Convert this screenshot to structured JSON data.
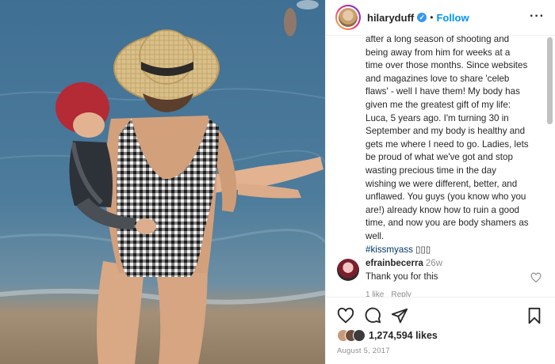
{
  "post": {
    "username": "hilaryduff",
    "verified_mark": "✓",
    "separator": "•",
    "follow_label": "Follow",
    "more_label": "···",
    "caption_lines": [
      "after a long season of shooting and",
      "being away from him for weeks at a",
      "time over those months. Since websites",
      "and magazines love to share 'celeb",
      "flaws' - well I have them! My body has",
      "given me the greatest gift of my life:",
      "Luca, 5 years ago. I'm turning 30 in",
      "September and my body is healthy and",
      "gets me where I need to go. Ladies, lets",
      "be proud of what we've got and stop",
      "wasting precious time in the day",
      "wishing we were different, better, and",
      "unflawed. You guys (you know who you",
      "are!) already know how to ruin a good",
      "time, and now you are body shamers as",
      "well."
    ],
    "hashtag": "#kissmyass",
    "emoji_tail": "▯▯▯",
    "likes": "1,274,594 likes",
    "date": "August 5, 2017"
  },
  "comment": {
    "username": "efrainbecerra",
    "time": "26w",
    "text": "Thank you for this",
    "like_label": "1 like",
    "reply_label": "Reply"
  },
  "icons": {
    "heart": "heart-icon",
    "comment": "comment-icon",
    "share": "paper-plane-icon",
    "save": "bookmark-icon",
    "verified": "verified-badge-icon",
    "more": "more-options-icon"
  },
  "colors": {
    "accent": "#0095f6",
    "verified": "#3897f0",
    "text": "#262626",
    "muted": "#8e8e8e"
  }
}
